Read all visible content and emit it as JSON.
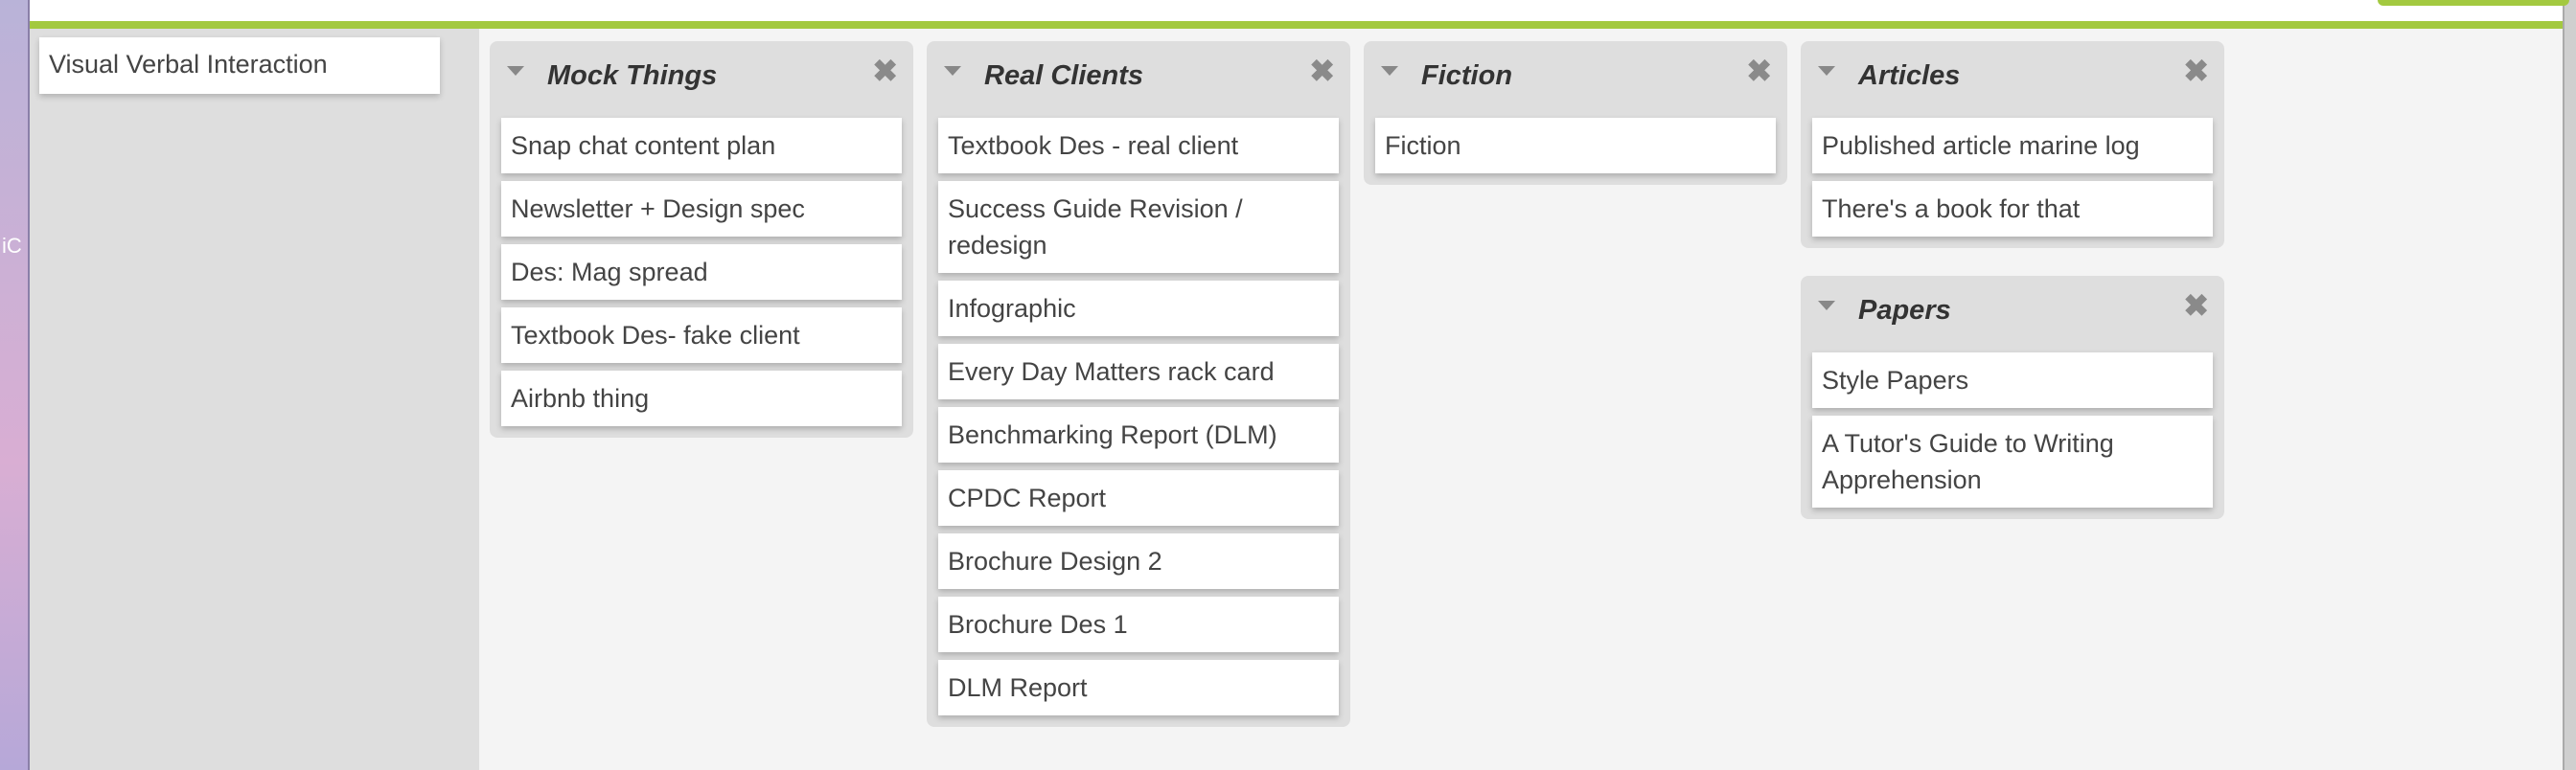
{
  "desktop_text": "iC",
  "sidebar": {
    "items": [
      {
        "label": "Visual Verbal Interaction"
      }
    ]
  },
  "columns": [
    {
      "title": "Mock Things",
      "cards": [
        "Snap chat content plan",
        "Newsletter + Design spec",
        "Des: Mag spread",
        "Textbook Des- fake client",
        "Airbnb thing"
      ]
    },
    {
      "title": "Real Clients",
      "cards": [
        "Textbook Des - real client",
        "Success Guide Revision / redesign",
        "Infographic",
        "Every Day Matters rack card",
        "Benchmarking Report (DLM)",
        "CPDC Report",
        "Brochure Design 2",
        "Brochure Des 1",
        "DLM Report"
      ]
    },
    {
      "title": "Fiction",
      "cards": [
        "Fiction"
      ]
    },
    {
      "title": "Articles",
      "cards": [
        "Published article marine log",
        "There's a book for that"
      ]
    },
    {
      "title": "Papers",
      "cards": [
        "Style Papers",
        "A Tutor's Guide to Writing Apprehension"
      ]
    }
  ],
  "close_glyph": "✖",
  "colors": {
    "accent": "#a3c940",
    "column_bg": "#dedede",
    "page_bg": "#f4f4f4"
  }
}
